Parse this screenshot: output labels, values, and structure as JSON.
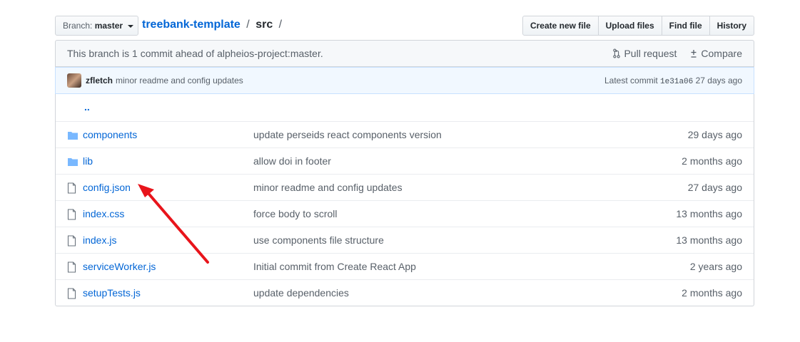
{
  "header": {
    "branch_prefix": "Branch:",
    "branch_name": "master",
    "repo": "treebank-template",
    "separator": "/",
    "directory": "src",
    "trailing_separator": "/",
    "buttons": {
      "create_new_file": "Create new file",
      "upload_files": "Upload files",
      "find_file": "Find file",
      "history": "History"
    }
  },
  "ahead_bar": {
    "text": "This branch is 1 commit ahead of alpheios-project:master.",
    "pull_request": "Pull request",
    "compare": "Compare"
  },
  "latest_commit": {
    "author": "zfletch",
    "message": "minor readme and config updates",
    "label": "Latest commit",
    "sha": "1e31a06",
    "age": "27 days ago"
  },
  "files": {
    "updir": "..",
    "rows": [
      {
        "type": "folder",
        "name": "components",
        "message": "update perseids react components version",
        "age": "29 days ago"
      },
      {
        "type": "folder",
        "name": "lib",
        "message": "allow doi in footer",
        "age": "2 months ago"
      },
      {
        "type": "file",
        "name": "config.json",
        "message": "minor readme and config updates",
        "age": "27 days ago"
      },
      {
        "type": "file",
        "name": "index.css",
        "message": "force body to scroll",
        "age": "13 months ago"
      },
      {
        "type": "file",
        "name": "index.js",
        "message": "use components file structure",
        "age": "13 months ago"
      },
      {
        "type": "file",
        "name": "serviceWorker.js",
        "message": "Initial commit from Create React App",
        "age": "2 years ago"
      },
      {
        "type": "file",
        "name": "setupTests.js",
        "message": "update dependencies",
        "age": "2 months ago"
      }
    ]
  },
  "colors": {
    "link": "#0366d6",
    "folder_icon": "#79b8ff",
    "annotation_arrow": "#e8141b"
  }
}
